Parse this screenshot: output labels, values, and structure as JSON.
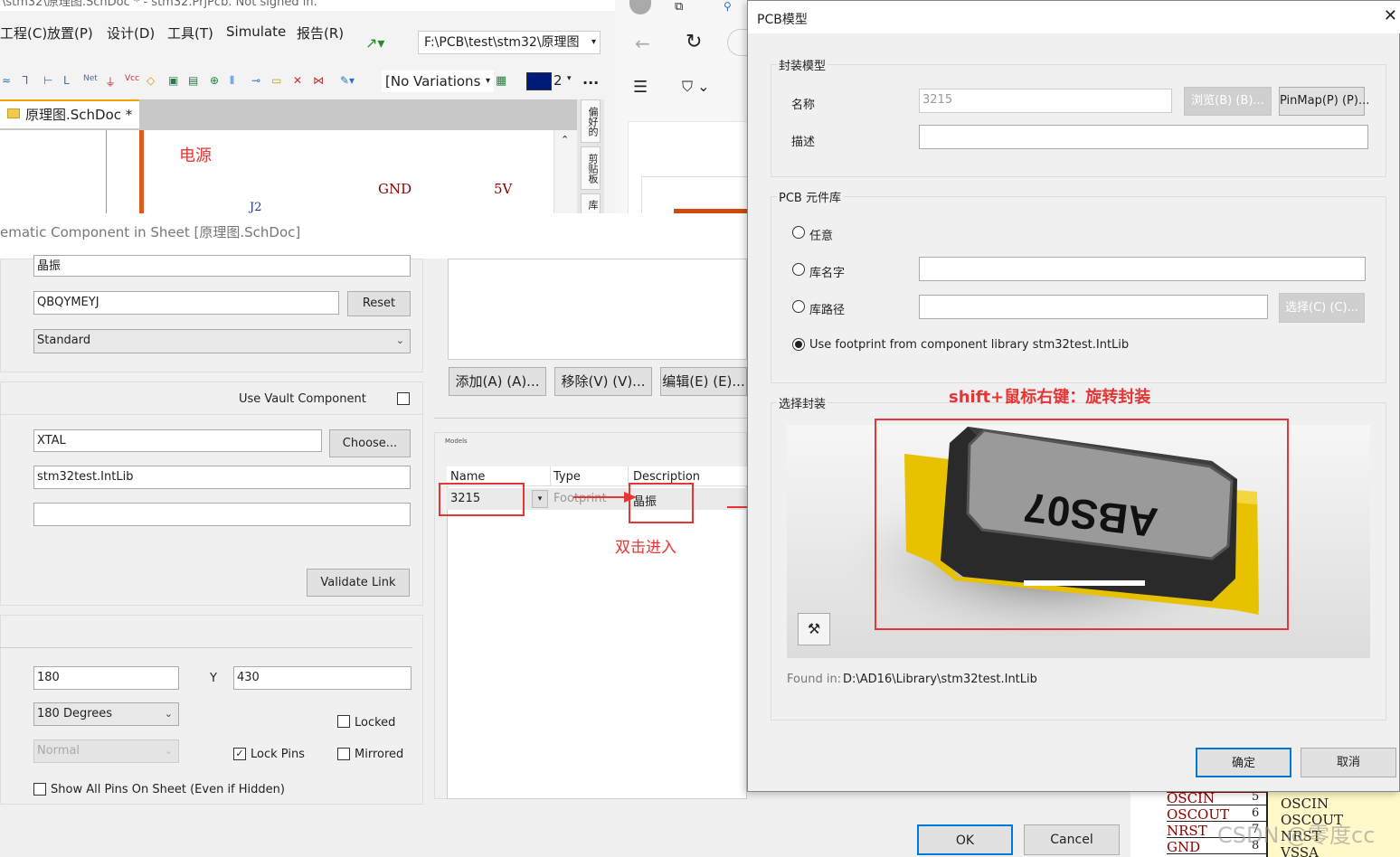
{
  "ad": {
    "title_text": "\\stm32\\原理图.SchDoc * - stm32.PrjPcb. Not signed in.",
    "menu": [
      "工程(C)",
      "放置(P)",
      "设计(D)",
      "工具(T)",
      "Simulate",
      "报告(R)"
    ],
    "path": "F:\\PCB\\test\\stm32\\原理图",
    "variations": "[No Variations",
    "color_count": "2",
    "more": "...",
    "doc_tab": "原理图.SchDoc *",
    "side_tabs": [
      "偏好的",
      "剪贴板",
      "库"
    ],
    "sheet_labels": {
      "power": "电源",
      "gnd": "GND",
      "v5": "5V",
      "ref": "J2"
    }
  },
  "props": {
    "header": "ematic Component in Sheet [原理图.SchDoc]",
    "comment_value": "晶振",
    "id_value": "QBQYMEYJ",
    "reset_label": "Reset",
    "type_value": "Standard",
    "use_vault_label": "Use Vault Component",
    "design_item_value": "XTAL",
    "choose_label": "Choose...",
    "library_value": "stm32test.IntLib",
    "extra_value": "",
    "validate_label": "Validate Link",
    "x_value": "180",
    "y_label": "Y",
    "y_value": "430",
    "rotation_value": "180 Degrees",
    "mode_value": "Normal",
    "locked_label": "Locked",
    "lock_pins_label": "Lock Pins",
    "mirrored_label": "Mirrored",
    "show_pins_label": "Show All Pins On Sheet (Even if Hidden)"
  },
  "models": {
    "add_label": "添加(A) (A)...",
    "remove_label": "移除(V) (V)...",
    "edit_label": "编辑(E) (E)...",
    "section_label": "Models",
    "columns": [
      "Name",
      "Type",
      "Description"
    ],
    "row": {
      "name": "3215",
      "type": "Footprint",
      "description": "晶振"
    },
    "note": "双击进入"
  },
  "pcb_dialog": {
    "title": "PCB模型",
    "close": "✕",
    "group_model": "封装模型",
    "name_label": "名称",
    "name_value": "3215",
    "browse_label": "浏览(B) (B)...",
    "pinmap_label": "PinMap(P) (P)...",
    "desc_label": "描述",
    "desc_value": "",
    "group_lib": "PCB 元件库",
    "opt_any": "任意",
    "opt_libname": "库名字",
    "opt_libpath": "库路径",
    "select_label": "选择(C) (C)...",
    "opt_use": "Use footprint from component library stm32test.IntLib",
    "group_select": "选择封装",
    "hint": "shift+鼠标右键：旋转封装",
    "chip_text": "ABS07",
    "found_label": "Found in:",
    "found_path": "D:\\AD16\\Library\\stm32test.IntLib",
    "ok_label": "确定",
    "cancel_label": "取消"
  },
  "footer": {
    "ok_label": "OK",
    "cancel_label": "Cancel"
  },
  "schematic": {
    "pins": [
      {
        "name": "OSCIN",
        "num": "5"
      },
      {
        "name": "OSCOUT",
        "num": "6"
      },
      {
        "name": "NRST",
        "num": "7"
      },
      {
        "name": "GND",
        "num": "8"
      }
    ],
    "right": [
      "OSCIN",
      "OSCOUT",
      "NRST",
      "VSSA"
    ],
    "watermark": "CSDN @零度cc"
  },
  "colors": {
    "accent_red": "#e53535",
    "chip_gold": "#e8c200"
  }
}
